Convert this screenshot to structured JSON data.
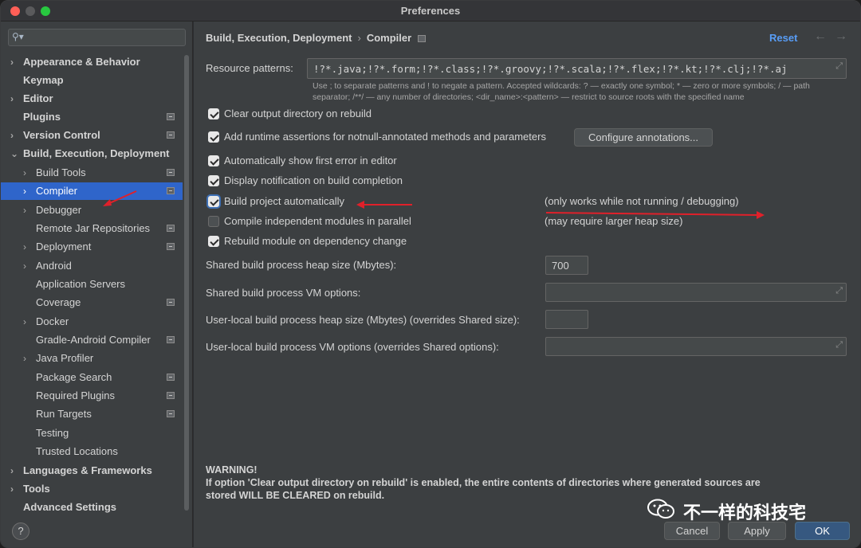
{
  "window": {
    "title": "Preferences"
  },
  "search": {
    "placeholder": ""
  },
  "sidebar": {
    "items": [
      {
        "label": "Appearance & Behavior",
        "chevron": "›"
      },
      {
        "label": "Keymap"
      },
      {
        "label": "Editor",
        "chevron": "›"
      },
      {
        "label": "Plugins"
      },
      {
        "label": "Version Control",
        "chevron": "›"
      },
      {
        "label": "Build, Execution, Deployment",
        "chevron": "⌄"
      },
      {
        "label": "Build Tools",
        "chevron": "›"
      },
      {
        "label": "Compiler",
        "chevron": "›"
      },
      {
        "label": "Debugger",
        "chevron": "›"
      },
      {
        "label": "Remote Jar Repositories"
      },
      {
        "label": "Deployment",
        "chevron": "›"
      },
      {
        "label": "Android",
        "chevron": "›"
      },
      {
        "label": "Application Servers"
      },
      {
        "label": "Coverage"
      },
      {
        "label": "Docker",
        "chevron": "›"
      },
      {
        "label": "Gradle-Android Compiler"
      },
      {
        "label": "Java Profiler",
        "chevron": "›"
      },
      {
        "label": "Package Search"
      },
      {
        "label": "Required Plugins"
      },
      {
        "label": "Run Targets"
      },
      {
        "label": "Testing"
      },
      {
        "label": "Trusted Locations"
      },
      {
        "label": "Languages & Frameworks",
        "chevron": "›"
      },
      {
        "label": "Tools",
        "chevron": "›"
      },
      {
        "label": "Advanced Settings"
      }
    ],
    "help_label": "?"
  },
  "header": {
    "crumb_parent": "Build, Execution, Deployment",
    "crumb_separator": "›",
    "crumb_current": "Compiler",
    "reset_label": "Reset",
    "back_icon": "←",
    "forward_icon": "→"
  },
  "compiler": {
    "resource_patterns_label": "Resource patterns:",
    "resource_patterns_value": "!?*.java;!?*.form;!?*.class;!?*.groovy;!?*.scala;!?*.flex;!?*.kt;!?*.clj;!?*.aj",
    "hint_line1": "Use ; to separate patterns and ! to negate a pattern. Accepted wildcards: ? — exactly one symbol; * — zero or more symbols; / — path",
    "hint_line2": "separator; /**/ — any number of directories; <dir_name>:<pattern> — restrict to source roots with the specified name",
    "options": [
      {
        "label": "Clear output directory on rebuild",
        "checked": true
      },
      {
        "label": "Add runtime assertions for notnull-annotated methods and parameters",
        "checked": true
      },
      {
        "label": "Automatically show first error in editor",
        "checked": true
      },
      {
        "label": "Display notification on build completion",
        "checked": true
      },
      {
        "label": "Build project automatically",
        "checked": true
      },
      {
        "label": "Compile independent modules in parallel",
        "checked": false
      },
      {
        "label": "Rebuild module on dependency change",
        "checked": true
      }
    ],
    "configure_annotations_label": "Configure annotations...",
    "note_build_auto": "(only works while not running / debugging)",
    "note_parallel": "(may require larger heap size)",
    "heap_label": "Shared build process heap size (Mbytes):",
    "heap_value": "700",
    "vm_options_label": "Shared build process VM options:",
    "vm_options_value": "",
    "user_heap_label": "User-local build process heap size (Mbytes) (overrides Shared size):",
    "user_heap_value": "",
    "user_vm_label": "User-local build process VM options (overrides Shared options):",
    "user_vm_value": "",
    "warning_title": "WARNING!",
    "warning_line1": "If option 'Clear output directory on rebuild' is enabled, the entire contents of directories where generated sources are",
    "warning_line2": "stored WILL BE CLEARED on rebuild."
  },
  "footer": {
    "cancel_label": "Cancel",
    "apply_label": "Apply",
    "ok_label": "OK"
  },
  "watermark": {
    "text": "不一样的科技宅"
  },
  "colors": {
    "accent": "#2f65ca",
    "link": "#589df6",
    "annotation_arrow": "#e0202a"
  }
}
